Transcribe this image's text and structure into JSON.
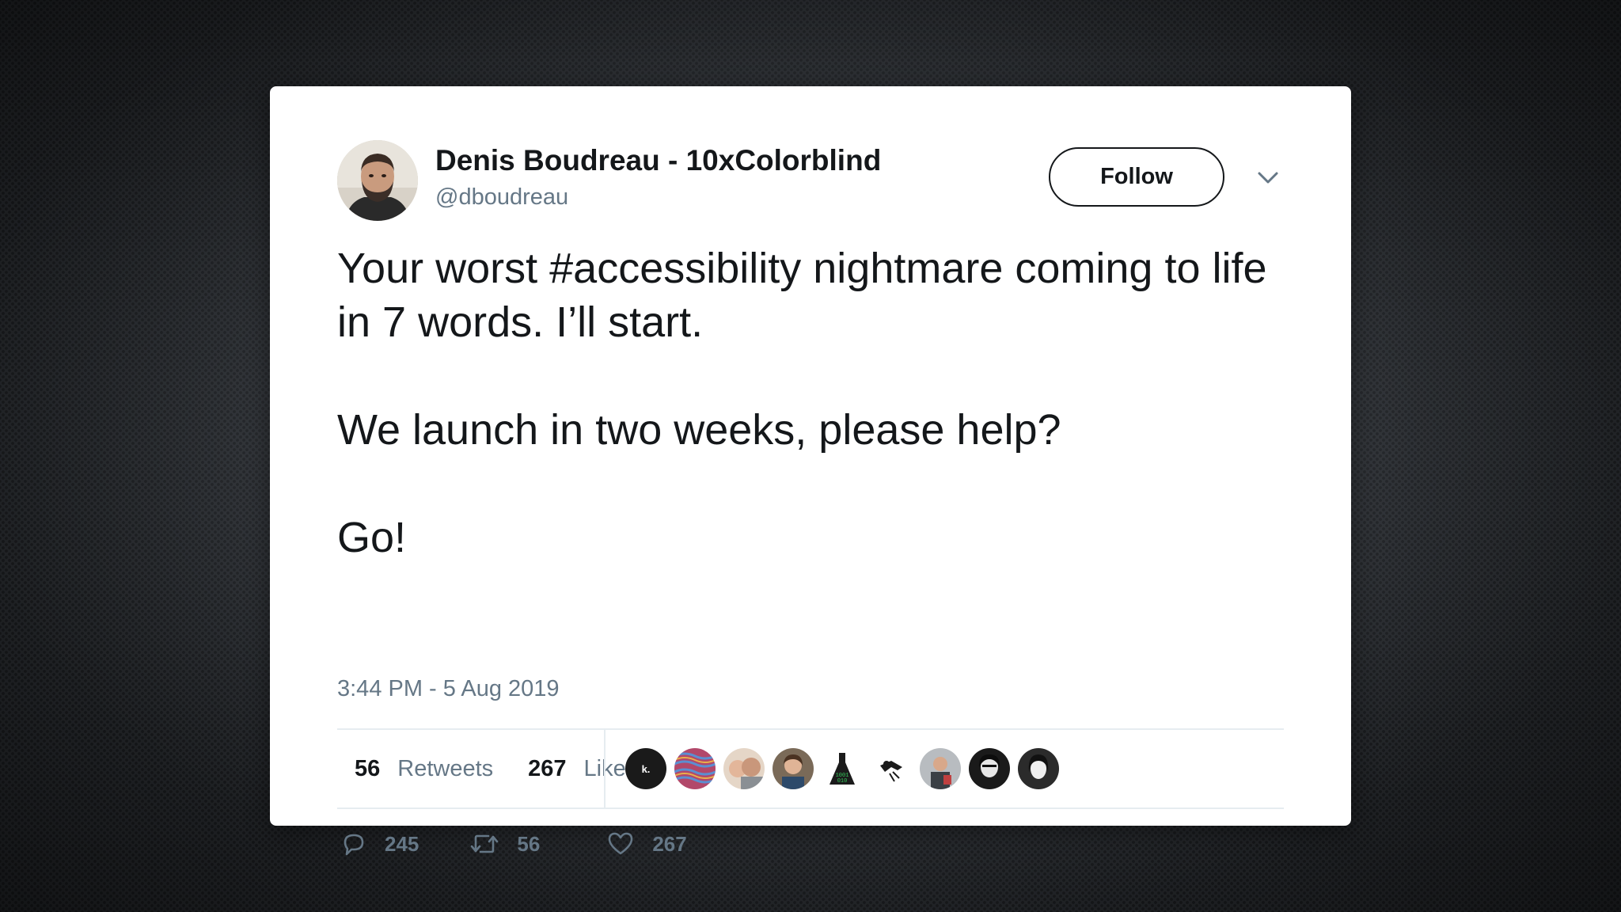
{
  "tweet": {
    "author": {
      "display_name": "Denis Boudreau - 10xColorblind",
      "handle": "@dboudreau",
      "avatar_icon": "profile-photo"
    },
    "follow_label": "Follow",
    "menu_icon": "chevron-down-icon",
    "text": {
      "line1": "Your worst #accessibility nightmare coming to life in 7 words. I’ll start.",
      "line2": "We launch in two weeks, please help?",
      "line3": "Go!"
    },
    "timestamp": "3:44 PM - 5 Aug 2019",
    "stats": {
      "retweets_count": "56",
      "retweets_label": "Retweets",
      "likes_count": "267",
      "likes_label": "Likes"
    },
    "likers": [
      {
        "initial": "k.",
        "color": "#1a1a1a"
      },
      {
        "initial": "",
        "color": "#b2486a"
      },
      {
        "initial": "",
        "color": "#c9a58b"
      },
      {
        "initial": "",
        "color": "#6b5a4a"
      },
      {
        "initial": "",
        "color": "#1f5e2e"
      },
      {
        "initial": "",
        "color": "#ffffff"
      },
      {
        "initial": "",
        "color": "#8a8f94"
      },
      {
        "initial": "",
        "color": "#222222"
      },
      {
        "initial": "",
        "color": "#2b2b2b"
      }
    ],
    "actions": {
      "reply_count": "245",
      "retweet_count": "56",
      "like_count": "267"
    }
  },
  "colors": {
    "text_primary": "#14171a",
    "text_secondary": "#657786",
    "divider": "#e6ecf0",
    "card_background": "#ffffff"
  }
}
